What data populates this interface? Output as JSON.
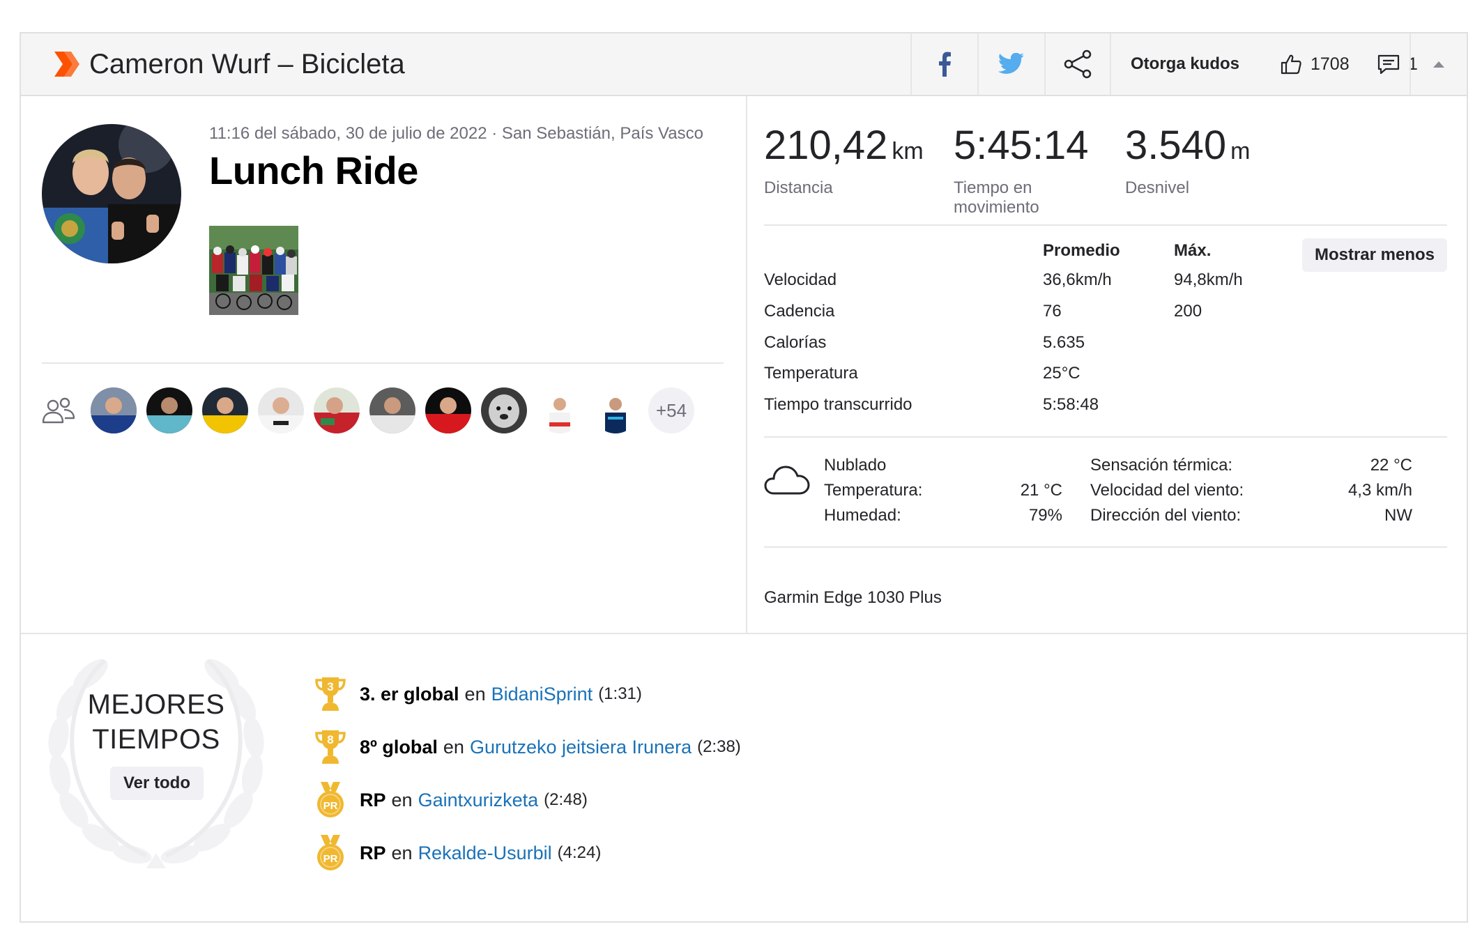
{
  "header": {
    "title": "Cameron Wurf – Bicicleta",
    "kudos_label": "Otorga kudos",
    "kudos_count": "1708",
    "comments_count": "1",
    "icons": [
      "strava-chevron-icon",
      "facebook-icon",
      "twitter-icon",
      "share-icon",
      "thumbs-up-icon",
      "comment-icon",
      "caret-up-icon"
    ]
  },
  "activity": {
    "meta": "11:16 del sábado, 30 de julio de 2022 · San Sebastián, País Vasco",
    "title": "Lunch Ride",
    "more_athletes": "+54"
  },
  "stats": [
    {
      "value": "210,42",
      "unit": "km",
      "label": "Distancia"
    },
    {
      "value": "5:45:14",
      "unit": "",
      "label": "Tiempo en movimiento"
    },
    {
      "value": "3.540",
      "unit": "m",
      "label": "Desnivel"
    }
  ],
  "details": {
    "col_avg": "Promedio",
    "col_max": "Máx.",
    "toggle_label": "Mostrar menos",
    "rows": [
      {
        "label": "Velocidad",
        "avg": "36,6km/h",
        "max": "94,8km/h"
      },
      {
        "label": "Cadencia",
        "avg": "76",
        "max": "200"
      },
      {
        "label": "Calorías",
        "avg": "5.635",
        "max": ""
      },
      {
        "label": "Temperatura",
        "avg": "25°C",
        "max": ""
      },
      {
        "label": "Tiempo transcurrido",
        "avg": "5:58:48",
        "max": ""
      }
    ]
  },
  "weather": {
    "condition": "Nublado",
    "temp_label": "Temperatura:",
    "temp_value": "21 °C",
    "humidity_label": "Humedad:",
    "humidity_value": "79%",
    "feels_label": "Sensación térmica:",
    "feels_value": "22 °C",
    "wind_speed_label": "Velocidad del viento:",
    "wind_speed_value": "4,3 km/h",
    "wind_dir_label": "Dirección del viento:",
    "wind_dir_value": "NW"
  },
  "device": "Garmin Edge 1030 Plus",
  "best": {
    "title_line1": "MEJORES",
    "title_line2": "TIEMPOS",
    "view_all": "Ver todo",
    "connector": "en",
    "items": [
      {
        "rank": "3. er global",
        "badge": "3",
        "segment": "BidaniSprint",
        "time": "(1:31)"
      },
      {
        "rank": "8º global",
        "badge": "8",
        "segment": "Gurutzeko jeitsiera Irunera",
        "time": "(2:38)"
      },
      {
        "rank": "RP",
        "badge": "PR",
        "segment": "Gaintxurizketa",
        "time": "(2:48)"
      },
      {
        "rank": "RP",
        "badge": "PR",
        "segment": "Rekalde-Usurbil",
        "time": "(4:24)"
      }
    ]
  },
  "colors": {
    "brand": "#fc5200",
    "link": "#1a72b8",
    "trophy": "#f0b830",
    "header_bg": "#f5f5f5"
  }
}
